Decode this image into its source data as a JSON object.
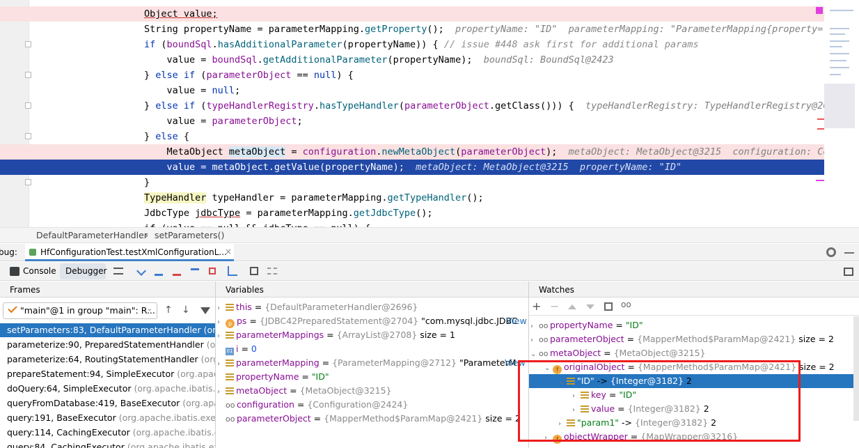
{
  "editor": {
    "lines": [
      {
        "parts": [
          [
            "Object value;",
            "ul"
          ]
        ]
      },
      {
        "parts": [
          [
            "String propertyName = parameterMapping.",
            ""
          ],
          [
            "getProperty",
            "fn"
          ],
          [
            "();  ",
            ""
          ],
          [
            "propertyName: \"ID\"  parameterMapping: \"ParameterMapping{property='I",
            "inl"
          ]
        ]
      },
      {
        "parts": [
          [
            "if",
            "kw"
          ],
          [
            " (",
            ""
          ],
          [
            "boundSql",
            "fld"
          ],
          [
            ".",
            ""
          ],
          [
            "hasAdditionalParameter",
            "fn"
          ],
          [
            "(propertyName)) { ",
            ""
          ],
          [
            "// issue #448 ask first for additional params",
            "cm"
          ]
        ]
      },
      {
        "parts": [
          [
            "    value = ",
            ""
          ],
          [
            "boundSql",
            "fld"
          ],
          [
            ".",
            ""
          ],
          [
            "getAdditionalParameter",
            "fn"
          ],
          [
            "(propertyName);  ",
            ""
          ],
          [
            "boundSql: BoundSql@2423",
            "inl"
          ]
        ]
      },
      {
        "parts": [
          [
            "} ",
            ""
          ],
          [
            "else if",
            "kw"
          ],
          [
            " (",
            ""
          ],
          [
            "parameterObject",
            "fld"
          ],
          [
            " == ",
            ""
          ],
          [
            "null",
            "kw"
          ],
          [
            ") {",
            ""
          ]
        ]
      },
      {
        "parts": [
          [
            "    value = ",
            ""
          ],
          [
            "null",
            "kw"
          ],
          [
            ";",
            ""
          ]
        ]
      },
      {
        "parts": [
          [
            "} ",
            ""
          ],
          [
            "else if",
            "kw"
          ],
          [
            " (",
            ""
          ],
          [
            "typeHandlerRegistry",
            "fld"
          ],
          [
            ".",
            ""
          ],
          [
            "hasTypeHandler",
            "fn"
          ],
          [
            "(",
            ""
          ],
          [
            "parameterObject",
            "fld"
          ],
          [
            ".getClass())) {  ",
            ""
          ],
          [
            "typeHandlerRegistry: TypeHandlerRegistry@269",
            "inl"
          ]
        ]
      },
      {
        "parts": [
          [
            "    value = ",
            ""
          ],
          [
            "parameterObject",
            "fld"
          ],
          [
            ";",
            ""
          ]
        ]
      },
      {
        "parts": [
          [
            "} ",
            ""
          ],
          [
            "else",
            "kw"
          ],
          [
            " {",
            ""
          ]
        ]
      },
      {
        "parts": [
          [
            "    MetaObject ",
            ""
          ],
          [
            "metaObject",
            "hl-var"
          ],
          [
            " = ",
            ""
          ],
          [
            "configuration",
            "fld"
          ],
          [
            ".",
            ""
          ],
          [
            "newMetaObject",
            "fn"
          ],
          [
            "(",
            ""
          ],
          [
            "parameterObject",
            "fld"
          ],
          [
            ");  ",
            ""
          ],
          [
            "metaObject: MetaObject@3215  configuration: Con",
            "inl"
          ]
        ]
      },
      {
        "parts": [
          [
            "    value = metaObject.getValue(propertyName);  ",
            ""
          ],
          [
            "metaObject: MetaObject@3215  propertyName: \"ID\"",
            "inl"
          ]
        ]
      },
      {
        "parts": [
          [
            "}",
            ""
          ]
        ]
      },
      {
        "parts": [
          [
            "TypeHandler",
            "hl-type"
          ],
          [
            " typeHandler = parameterMapping.",
            ""
          ],
          [
            "getTypeHandler",
            "fn"
          ],
          [
            "();",
            ""
          ]
        ]
      },
      {
        "parts": [
          [
            "JdbcType ",
            ""
          ],
          [
            "jdbcType",
            "ul"
          ],
          [
            " = parameterMapping.",
            ""
          ],
          [
            "getJdbcType",
            "fn"
          ],
          [
            "();",
            ""
          ]
        ]
      },
      {
        "parts": [
          [
            "if (value == null && jdbcType == null) {",
            ""
          ]
        ]
      }
    ]
  },
  "breadcrumb": {
    "class_name": "DefaultParameterHandler",
    "separator": "›",
    "method": "setParameters()"
  },
  "debug": {
    "label": "bug:",
    "session_tab": "HfConfigurationTest.testXmlConfigurationL...",
    "close": "×",
    "console_tab": "Console",
    "debugger_tab": "Debugger"
  },
  "frames": {
    "header": "Frames",
    "thread": "\"main\"@1 in group \"main\": R...",
    "items": [
      {
        "method": "setParameters:83, DefaultParameterHandler",
        "pkg": "(org.ap"
      },
      {
        "method": "parameterize:90, PreparedStatementHandler",
        "pkg": "(org.a"
      },
      {
        "method": "parameterize:64, RoutingStatementHandler",
        "pkg": "(org.ap"
      },
      {
        "method": "prepareStatement:94, SimpleExecutor",
        "pkg": "(org.apache.i"
      },
      {
        "method": "doQuery:64, SimpleExecutor",
        "pkg": "(org.apache.ibatis.exec"
      },
      {
        "method": "queryFromDatabase:419, BaseExecutor",
        "pkg": "(org.apache"
      },
      {
        "method": "query:191, BaseExecutor",
        "pkg": "(org.apache.ibatis.executo"
      },
      {
        "method": "query:114, CachingExecutor",
        "pkg": "(org.apache.ibatis.exec"
      },
      {
        "method": "query:84, CachingExecutor",
        "pkg": "(org.apache.ibatis.exec"
      }
    ]
  },
  "variables": {
    "header": "Variables",
    "items": [
      {
        "name": "this",
        "eq": " = ",
        "value": "{DefaultParameterHandler@2696}",
        "extra": "",
        "link": ""
      },
      {
        "name": "ps",
        "eq": " = ",
        "value": "{JDBC42PreparedStatement@2704}",
        "extra": " \"com.mysql.jdbc.JDBC",
        "link": "View"
      },
      {
        "name": "parameterMappings",
        "eq": " = ",
        "value": "{ArrayList@2708}",
        "extra": "  size = 1",
        "link": ""
      },
      {
        "name": "i",
        "eq": " = ",
        "value": "0",
        "extra": "",
        "link": ""
      },
      {
        "name": "parameterMapping",
        "eq": " = ",
        "value": "{ParameterMapping@2712}",
        "extra": " \"ParameterM",
        "link": "View"
      },
      {
        "name": "propertyName",
        "eq": " = ",
        "value": "\"ID\"",
        "extra": "",
        "link": ""
      },
      {
        "name": "metaObject",
        "eq": " = ",
        "value": "{MetaObject@3215}",
        "extra": "",
        "link": ""
      },
      {
        "name": "configuration",
        "eq": " = ",
        "value": "{Configuration@2424}",
        "extra": "",
        "link": ""
      },
      {
        "name": "parameterObject",
        "eq": " = ",
        "value": "{MapperMethod$ParamMap@2421}",
        "extra": "  size = 2",
        "link": ""
      }
    ]
  },
  "watches": {
    "header": "Watches",
    "items": [
      {
        "name": "propertyName",
        "eq": " = ",
        "value": "\"ID\"",
        "extra": ""
      },
      {
        "name": "parameterObject",
        "eq": " = ",
        "value": "{MapperMethod$ParamMap@2421}",
        "extra": "  size = 2"
      },
      {
        "name": "metaObject",
        "eq": " = ",
        "value": "{MetaObject@3215}",
        "extra": ""
      },
      {
        "name": "originalObject",
        "eq": " = ",
        "value": "{MapperMethod$ParamMap@2421}",
        "extra": "  size = 2"
      },
      {
        "name": "\"ID\"",
        "eq": " -> ",
        "value": "{Integer@3182}",
        "extra": " 2"
      },
      {
        "name": "key",
        "eq": " = ",
        "value": "\"ID\"",
        "extra": ""
      },
      {
        "name": "value",
        "eq": " = ",
        "value": "{Integer@3182}",
        "extra": " 2"
      },
      {
        "name": "\"param1\"",
        "eq": " -> ",
        "value": "{Integer@3182}",
        "extra": " 2"
      },
      {
        "name": "objectWrapper",
        "eq": " = ",
        "value": "{MapWrapper@3216}",
        "extra": ""
      }
    ]
  }
}
